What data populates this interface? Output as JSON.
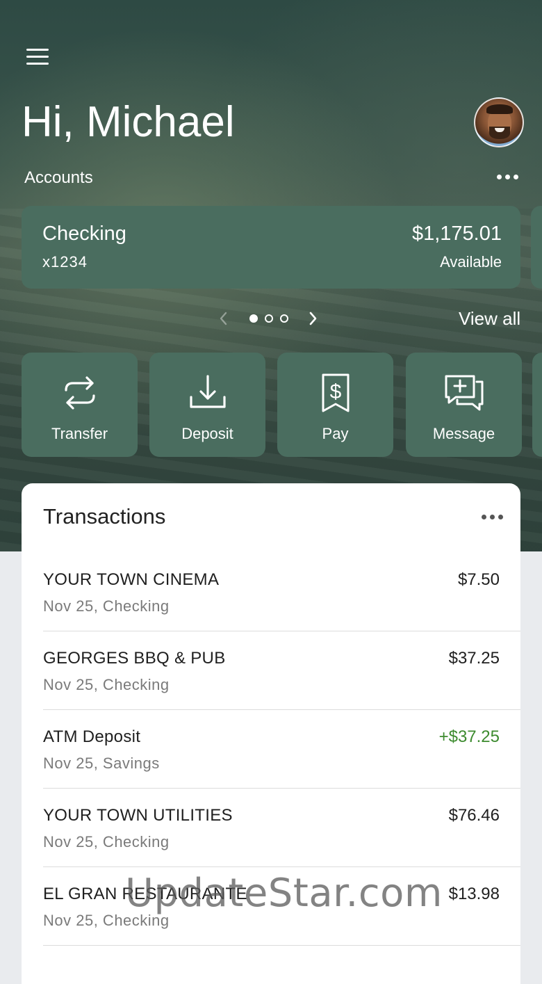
{
  "header": {
    "greeting": "Hi, Michael",
    "accounts_label": "Accounts"
  },
  "account_card": {
    "name": "Checking",
    "number": "x1234",
    "balance": "$1,175.01",
    "balance_label": "Available"
  },
  "carousel": {
    "page_count": 3,
    "active_page": 1,
    "view_all": "View all"
  },
  "actions": [
    {
      "label": "Transfer",
      "icon": "transfer-icon"
    },
    {
      "label": "Deposit",
      "icon": "deposit-icon"
    },
    {
      "label": "Pay",
      "icon": "pay-bill-icon"
    },
    {
      "label": "Message",
      "icon": "message-icon"
    }
  ],
  "transactions": {
    "title": "Transactions",
    "items": [
      {
        "name": "YOUR TOWN CINEMA",
        "detail": "Nov 25, Checking",
        "amount": "$7.50",
        "credit": false
      },
      {
        "name": "GEORGES BBQ & PUB",
        "detail": "Nov 25, Checking",
        "amount": "$37.25",
        "credit": false
      },
      {
        "name": "ATM Deposit",
        "detail": "Nov 25, Savings",
        "amount": "+$37.25",
        "credit": true
      },
      {
        "name": "YOUR TOWN UTILITIES",
        "detail": "Nov 25, Checking",
        "amount": "$76.46",
        "credit": false
      },
      {
        "name": "EL GRAN RESTAURANTE",
        "detail": "Nov 25, Checking",
        "amount": "$13.98",
        "credit": false
      }
    ]
  },
  "watermark": "UpdateStar.com",
  "colors": {
    "card": "#4a6d5f",
    "credit": "#3d8b2f",
    "hero": "#2e4a44"
  }
}
